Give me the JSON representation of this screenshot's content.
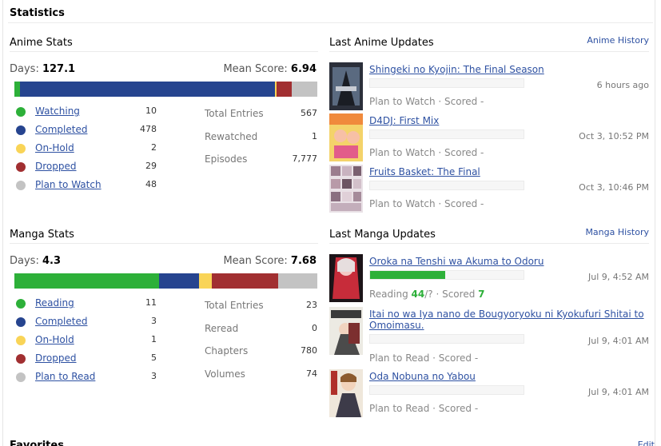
{
  "title": "Statistics",
  "colors": {
    "watching": "#2db039",
    "completed": "#26448f",
    "onhold": "#f9d457",
    "dropped": "#a12f31",
    "plan": "#c3c3c3",
    "link": "#2e51a2"
  },
  "anime": {
    "heading": "Anime Stats",
    "days_label": "Days:",
    "days": "127.1",
    "mean_label": "Mean Score:",
    "mean": "6.94",
    "bar": [
      {
        "status": "watching",
        "fraction": 0.0177
      },
      {
        "status": "completed",
        "fraction": 0.8446
      },
      {
        "status": "onhold",
        "fraction": 0.0035
      },
      {
        "status": "dropped",
        "fraction": 0.0512
      },
      {
        "status": "plan",
        "fraction": 0.0848
      }
    ],
    "statuses": [
      {
        "label": "Watching",
        "count": "10",
        "color": "#2db039"
      },
      {
        "label": "Completed",
        "count": "478",
        "color": "#26448f"
      },
      {
        "label": "On-Hold",
        "count": "2",
        "color": "#f9d457"
      },
      {
        "label": "Dropped",
        "count": "29",
        "color": "#a12f31"
      },
      {
        "label": "Plan to Watch",
        "count": "48",
        "color": "#c3c3c3"
      }
    ],
    "totals": [
      {
        "label": "Total Entries",
        "value": "567"
      },
      {
        "label": "Rewatched",
        "value": "1"
      },
      {
        "label": "Episodes",
        "value": "7,777"
      }
    ]
  },
  "manga": {
    "heading": "Manga Stats",
    "days_label": "Days:",
    "days": "4.3",
    "mean_label": "Mean Score:",
    "mean": "7.68",
    "bar": [
      {
        "status": "watching",
        "fraction": 0.4783
      },
      {
        "status": "completed",
        "fraction": 0.1304
      },
      {
        "status": "onhold",
        "fraction": 0.0435
      },
      {
        "status": "dropped",
        "fraction": 0.2174
      },
      {
        "status": "plan",
        "fraction": 0.1304
      }
    ],
    "statuses": [
      {
        "label": "Reading",
        "count": "11",
        "color": "#2db039"
      },
      {
        "label": "Completed",
        "count": "3",
        "color": "#26448f"
      },
      {
        "label": "On-Hold",
        "count": "1",
        "color": "#f9d457"
      },
      {
        "label": "Dropped",
        "count": "5",
        "color": "#a12f31"
      },
      {
        "label": "Plan to Read",
        "count": "3",
        "color": "#c3c3c3"
      }
    ],
    "totals": [
      {
        "label": "Total Entries",
        "value": "23"
      },
      {
        "label": "Reread",
        "value": "0"
      },
      {
        "label": "Chapters",
        "value": "780"
      },
      {
        "label": "Volumes",
        "value": "74"
      }
    ]
  },
  "anime_updates": {
    "heading": "Last Anime Updates",
    "history_link": "Anime History",
    "items": [
      {
        "title": "Shingeki no Kyojin: The Final Season",
        "time": "6 hours ago",
        "status": "Plan to Watch · Scored -",
        "progress": 0
      },
      {
        "title": "D4DJ: First Mix",
        "time": "Oct 3, 10:52 PM",
        "status": "Plan to Watch · Scored -",
        "progress": 0
      },
      {
        "title": "Fruits Basket: The Final",
        "time": "Oct 3, 10:46 PM",
        "status": "Plan to Watch · Scored -",
        "progress": 0
      }
    ]
  },
  "manga_updates": {
    "heading": "Last Manga Updates",
    "history_link": "Manga History",
    "items": [
      {
        "title": "Oroka na Tenshi wa Akuma to Odoru",
        "time": "Jul 9, 4:52 AM",
        "status_prefix": "Reading ",
        "status_progress": "44",
        "status_mid": "/? · Scored ",
        "status_score": "7",
        "progress": 0.49
      },
      {
        "title": "Itai no wa Iya nano de Bougyoryoku ni Kyokufuri Shitai to Omoimasu.",
        "time": "Jul 9, 4:01 AM",
        "status": "Plan to Read · Scored -",
        "progress": 0
      },
      {
        "title": "Oda Nobuna no Yabou",
        "time": "Jul 9, 4:01 AM",
        "status": "Plan to Read · Scored -",
        "progress": 0
      }
    ]
  },
  "footer": {
    "title": "Favorites",
    "edit": "Edit"
  }
}
